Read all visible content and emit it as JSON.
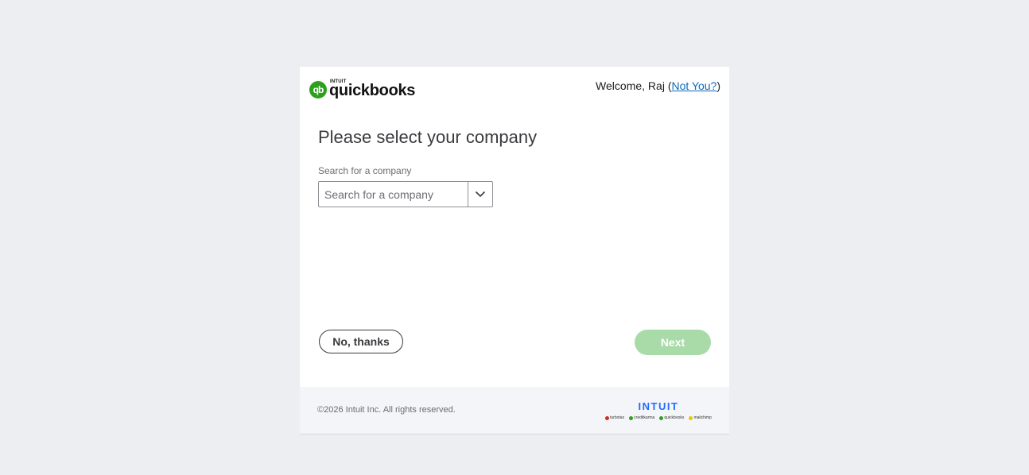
{
  "header": {
    "logo_brand_small": "INTUIT",
    "logo_brand": "quickbooks",
    "logo_mark": "qb",
    "welcome_prefix": "Welcome, Raj (",
    "not_you_link": "Not You?",
    "welcome_suffix": ")"
  },
  "main": {
    "title": "Please select your company",
    "search_label": "Search for a company",
    "search_placeholder": "Search for a company",
    "search_value": ""
  },
  "actions": {
    "secondary_label": "No, thanks",
    "primary_label": "Next",
    "primary_enabled": false
  },
  "footer": {
    "copyright": "©2026 Intuit Inc. All rights reserved.",
    "intuit_word": "INTUIT",
    "brands": [
      {
        "name": "turbotax",
        "color": "#d52b1e"
      },
      {
        "name": "creditkarma",
        "color": "#2ca01c"
      },
      {
        "name": "quickbooks",
        "color": "#2ca01c"
      },
      {
        "name": "mailchimp",
        "color": "#ffe01b"
      }
    ]
  },
  "colors": {
    "accent_green": "#2ca01c",
    "disabled_green": "#a8dba8",
    "link_blue": "#0a6abf",
    "intuit_blue": "#236cff",
    "page_bg": "#eceef1"
  },
  "icons": {
    "dropdown": "chevron-down-icon",
    "logo": "quickbooks-logo-icon"
  }
}
